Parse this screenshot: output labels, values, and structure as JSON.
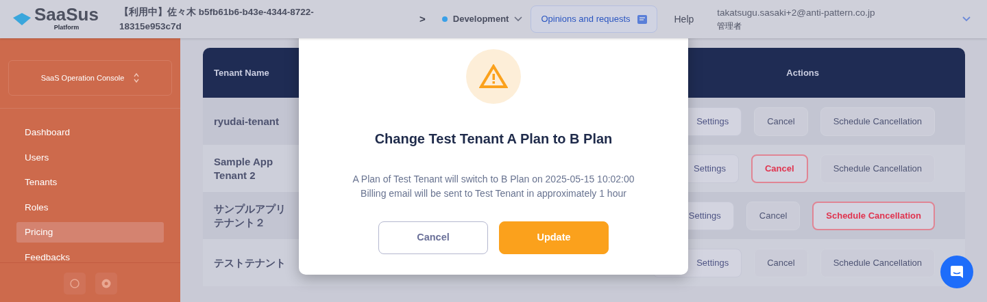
{
  "header": {
    "logo": {
      "name": "SaaSus",
      "subtitle": "Platform"
    },
    "tenant_lines": [
      "【利用中】佐々木 b5fb61b6-b43e-4344-8722-",
      "18315e953c7d"
    ],
    "separator": ">",
    "environment": {
      "label": "Development",
      "color": "#3aa0e8"
    },
    "feedback_button": "Opinions and requests",
    "help": "Help",
    "user": {
      "email": "takatsugu.sasaki+2@anti-pattern.co.jp",
      "role": "管理者"
    }
  },
  "sidebar": {
    "console_selector": "SaaS Operation Console",
    "items": [
      {
        "label": "Dashboard",
        "selected": false
      },
      {
        "label": "Users",
        "selected": false
      },
      {
        "label": "Tenants",
        "selected": false
      },
      {
        "label": "Roles",
        "selected": false
      },
      {
        "label": "Pricing",
        "selected": true
      },
      {
        "label": "Feedbacks",
        "selected": false
      }
    ]
  },
  "table": {
    "columns": [
      "Tenant Name",
      "Actions"
    ],
    "rows": [
      {
        "name": "ryudai-tenant",
        "actions": [
          {
            "label": "Settings",
            "highlighted": false
          },
          {
            "label": "Cancel",
            "highlighted": false
          },
          {
            "label": "Schedule Cancellation",
            "highlighted": false
          }
        ]
      },
      {
        "name": "Sample App Tenant 2",
        "actions": [
          {
            "label": "Settings",
            "highlighted": false
          },
          {
            "label": "Cancel",
            "highlighted": true
          },
          {
            "label": "Schedule Cancellation",
            "highlighted": false
          }
        ]
      },
      {
        "name": "サンプルアプリテナント２",
        "actions": [
          {
            "label": "Settings",
            "highlighted": false
          },
          {
            "label": "Cancel",
            "highlighted": false
          },
          {
            "label": "Schedule Cancellation",
            "highlighted": true
          }
        ]
      },
      {
        "name": "テストテナント",
        "actions": [
          {
            "label": "Settings",
            "highlighted": false
          },
          {
            "label": "Cancel",
            "highlighted": false
          },
          {
            "label": "Schedule Cancellation",
            "highlighted": false
          }
        ]
      }
    ]
  },
  "modal": {
    "title": "Change Test Tenant A Plan to B Plan",
    "message": [
      "A Plan of Test Tenant will switch to B Plan on 2025-05-15 10:02:00",
      "Billing email will be sent to Test Tenant in approximately 1 hour"
    ],
    "buttons": [
      {
        "label": "Cancel",
        "kind": "secondary"
      },
      {
        "label": "Update",
        "kind": "primary"
      }
    ]
  }
}
